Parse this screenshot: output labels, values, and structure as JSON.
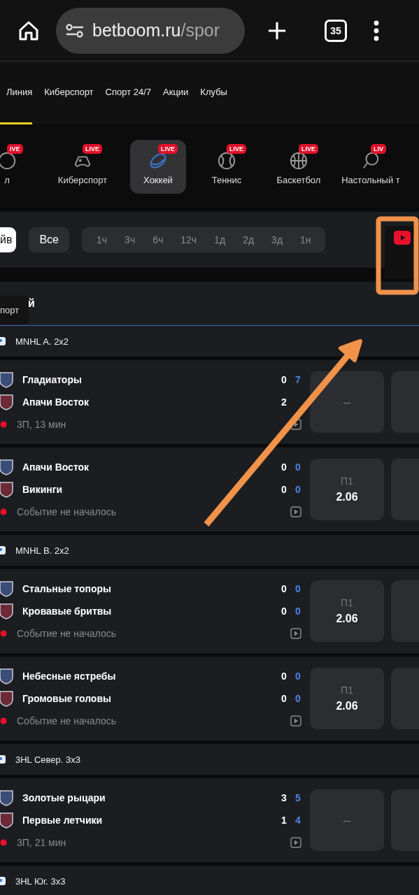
{
  "browser": {
    "url_host": "betboom.ru",
    "url_path": "/spor",
    "tab_count": "35"
  },
  "nav": [
    {
      "label": "Линия",
      "selected": true
    },
    {
      "label": "Киберспорт",
      "selected": false
    },
    {
      "label": "Спорт 24/7",
      "selected": false
    },
    {
      "label": "Акции",
      "selected": false
    },
    {
      "label": "Клубы",
      "selected": false
    }
  ],
  "sports": [
    {
      "label": "л",
      "badge": "IVE",
      "kind": "ball",
      "selected": false
    },
    {
      "label": "Киберспорт",
      "badge": "LIVE",
      "kind": "gamepad",
      "selected": false
    },
    {
      "label": "Хоккей",
      "badge": "LIVE",
      "kind": "puck",
      "selected": true
    },
    {
      "label": "Теннис",
      "badge": "LIVE",
      "kind": "tennis",
      "selected": false
    },
    {
      "label": "Баскетбол",
      "badge": "LIVE",
      "kind": "basketball",
      "selected": false
    },
    {
      "label": "Настольный т",
      "badge": "LIV",
      "kind": "pingpong",
      "selected": false
    }
  ],
  "filters": [
    {
      "label": "йв",
      "selected": true
    },
    {
      "label": "Все",
      "selected": false
    }
  ],
  "periods": [
    "1ч",
    "3ч",
    "6ч",
    "12ч",
    "1д",
    "2д",
    "3д",
    "1н"
  ],
  "section_title": "й",
  "tooltip": "порт",
  "leagues": [
    {
      "name": "MNHL A. 2x2",
      "matches": [
        {
          "teams": [
            {
              "name": "Гладиаторы",
              "score": "0",
              "total": "7"
            },
            {
              "name": "Апачи Восток",
              "score": "2"
            }
          ],
          "status": "3П, 13 мин",
          "odd": {
            "kind": "dash",
            "text": "–"
          }
        },
        {
          "teams": [
            {
              "name": "Апачи Восток",
              "score": "0",
              "total": "0"
            },
            {
              "name": "Викинги",
              "score": "0",
              "total": "0"
            }
          ],
          "status": "Событие не началось",
          "odd": {
            "kind": "price",
            "label": "П1",
            "value": "2.06"
          }
        }
      ]
    },
    {
      "name": "MNHL B. 2x2",
      "matches": [
        {
          "teams": [
            {
              "name": "Стальные топоры",
              "score": "0",
              "total": "0"
            },
            {
              "name": "Кровавые бритвы",
              "score": "0",
              "total": "0"
            }
          ],
          "status": "Событие не началось",
          "odd": {
            "kind": "price",
            "label": "П1",
            "value": "2.06"
          }
        },
        {
          "teams": [
            {
              "name": "Небесные ястребы",
              "score": "0",
              "total": "0"
            },
            {
              "name": "Громовые головы",
              "score": "0",
              "total": "0"
            }
          ],
          "status": "Событие не началось",
          "odd": {
            "kind": "price",
            "label": "П1",
            "value": "2.06"
          }
        }
      ]
    },
    {
      "name": "3HL Север. 3x3",
      "matches": [
        {
          "teams": [
            {
              "name": "Золотые рыцари",
              "score": "3",
              "total": "5"
            },
            {
              "name": "Первые летчики",
              "score": "1",
              "total": "4"
            }
          ],
          "status": "3П, 21 мин",
          "odd": {
            "kind": "dash",
            "text": "–"
          }
        }
      ]
    },
    {
      "name": "3HL Юг. 3x3"
    }
  ]
}
